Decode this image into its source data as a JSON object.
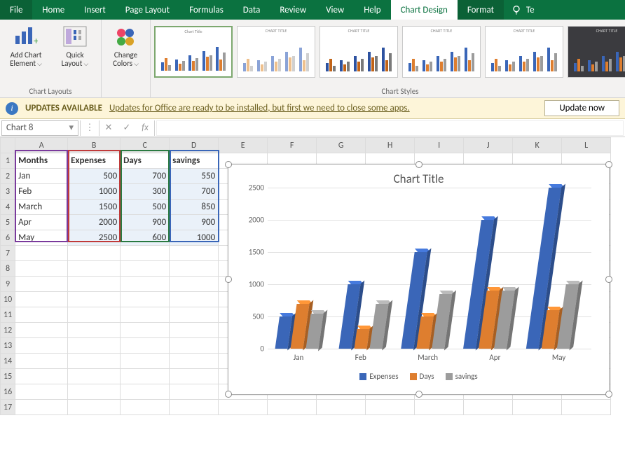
{
  "tabs": {
    "file": "File",
    "home": "Home",
    "insert": "Insert",
    "page_layout": "Page Layout",
    "formulas": "Formulas",
    "data": "Data",
    "review": "Review",
    "view": "View",
    "help": "Help",
    "chart_design": "Chart Design",
    "format": "Format",
    "tell": "Te"
  },
  "ribbon": {
    "add_chart_element": "Add Chart\nElement",
    "quick_layout": "Quick\nLayout",
    "chart_layouts": "Chart Layouts",
    "change_colors": "Change\nColors",
    "chart_styles": "Chart Styles"
  },
  "updatebar": {
    "title": "UPDATES AVAILABLE",
    "msg": "Updates for Office are ready to be installed, but first we need to close some apps.",
    "btn": "Update now"
  },
  "fbar": {
    "ref": "Chart 8",
    "fx": "fx",
    "cancel": "✕",
    "confirm": "✓"
  },
  "sheet": {
    "cols": [
      "A",
      "B",
      "C",
      "D",
      "E",
      "F",
      "G",
      "H",
      "I",
      "J",
      "K",
      "L"
    ],
    "headers": [
      "Months",
      "Expenses",
      "Days",
      "savings"
    ],
    "rows": [
      {
        "m": "Jan",
        "e": 500,
        "d": 700,
        "s": 550
      },
      {
        "m": "Feb",
        "e": 1000,
        "d": 300,
        "s": 700
      },
      {
        "m": "March",
        "e": 1500,
        "d": 500,
        "s": 850
      },
      {
        "m": "Apr",
        "e": 2000,
        "d": 900,
        "s": 900
      },
      {
        "m": "May",
        "e": 2500,
        "d": 600,
        "s": 1000
      }
    ]
  },
  "chart_data": {
    "type": "bar",
    "title": "Chart Title",
    "categories": [
      "Jan",
      "Feb",
      "March",
      "Apr",
      "May"
    ],
    "series": [
      {
        "name": "Expenses",
        "values": [
          500,
          1000,
          1500,
          2000,
          2500
        ],
        "color": "#3a66b8"
      },
      {
        "name": "Days",
        "values": [
          700,
          300,
          500,
          900,
          600
        ],
        "color": "#de7e2f"
      },
      {
        "name": "savings",
        "values": [
          550,
          700,
          850,
          900,
          1000
        ],
        "color": "#9c9c9c"
      }
    ],
    "ylim": [
      0,
      2500
    ],
    "yticks": [
      0,
      500,
      1000,
      1500,
      2000,
      2500
    ]
  }
}
